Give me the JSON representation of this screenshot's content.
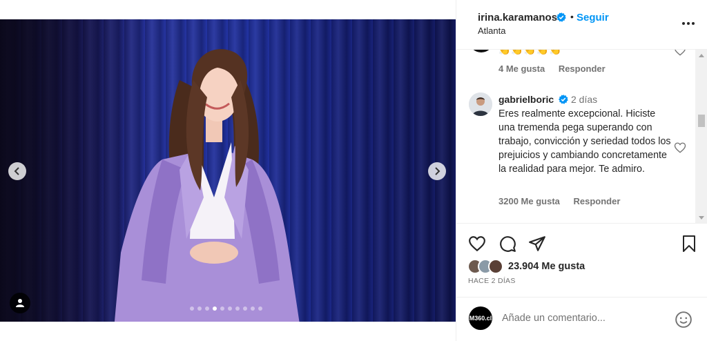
{
  "post": {
    "carousel": {
      "dot_count": 10,
      "active_index": 3
    }
  },
  "header": {
    "username": "irina.karamanos",
    "separator": "•",
    "follow_label": "Seguir",
    "location": "Atlanta"
  },
  "comments": {
    "previous": {
      "emojis": "👏👏👏👏👏",
      "likes": "4 Me gusta",
      "reply_label": "Responder"
    },
    "main": {
      "username": "gabrielboric",
      "time": "2 días",
      "text": "Eres realmente excepcional. Hiciste una tremenda pega superando con trabajo, convicción y seriedad todos los prejuicios y cambiando concretamente la realidad para mejor. Te admiro.",
      "likes": "3200 Me gusta",
      "reply_label": "Responder"
    }
  },
  "engagement": {
    "likes_text": "23.904 Me gusta",
    "posted_ago": "HACE 2 DÍAS"
  },
  "composer": {
    "placeholder": "Añade un comentario...",
    "avatar_text": "M360.cl"
  },
  "icons": {
    "verified": "verified-badge-icon",
    "like": "heart-icon",
    "comment": "comment-icon",
    "share": "share-icon",
    "save": "bookmark-icon",
    "emoji": "emoji-icon",
    "more": "more-options-icon"
  },
  "colors": {
    "link_blue": "#0095f6",
    "verified_blue": "#0095f6",
    "muted_text": "#737373",
    "outfit_lavender": "#a98fd8"
  }
}
